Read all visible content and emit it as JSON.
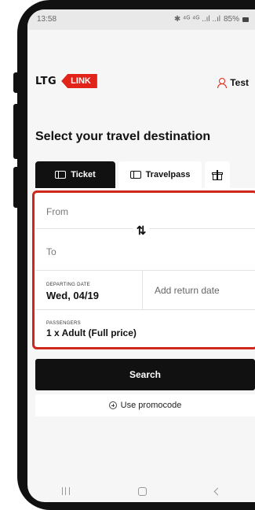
{
  "status_bar": {
    "time": "13:58",
    "icons": "✱ ⁴ᴳ ⁴ᴳ ..ıl ..ıl",
    "battery": "85%"
  },
  "header": {
    "logo_left": "LTG",
    "logo_right": "LINK",
    "user_name": "Test"
  },
  "page": {
    "title": "Select your travel destination"
  },
  "tabs": [
    {
      "label": "Ticket",
      "active": true
    },
    {
      "label": "Travelpass",
      "active": false
    }
  ],
  "form": {
    "from_placeholder": "From",
    "to_placeholder": "To",
    "swap_glyph": "⇅",
    "departing_label": "DEPARTING DATE",
    "departing_value": "Wed, 04/19",
    "return_placeholder": "Add return date",
    "passengers_label": "PASSENGERS",
    "passengers_value": "1 x Adult (Full price)"
  },
  "actions": {
    "search_label": "Search",
    "promo_label": "Use promocode"
  },
  "colors": {
    "accent": "#e2231a",
    "highlight": "#d0271d",
    "primary_button": "#111111"
  }
}
